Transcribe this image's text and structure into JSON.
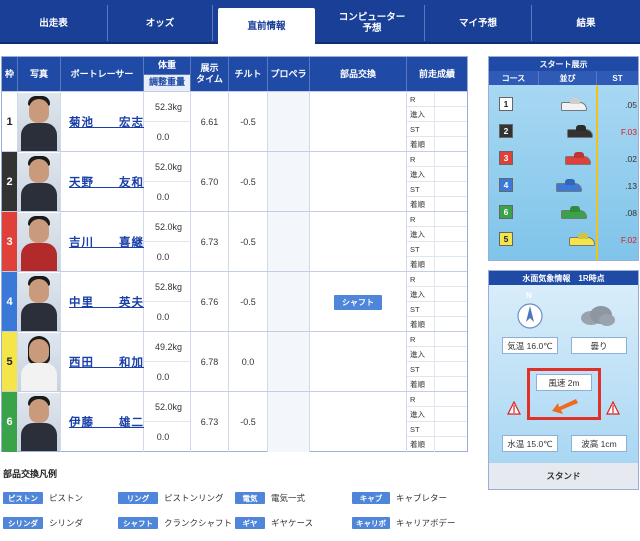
{
  "tabs": [
    {
      "label": "出走表"
    },
    {
      "label": "オッズ"
    },
    {
      "label": "直前情報",
      "active": true
    },
    {
      "label": "コンピューター\n予想"
    },
    {
      "label": "マイ予想"
    },
    {
      "label": "結果"
    }
  ],
  "table": {
    "headers": {
      "waku": "枠",
      "photo": "写真",
      "racer": "ボートレーサー",
      "weight_top": "体重",
      "weight_bottom": "調整重量",
      "exhibition": "展示\nタイム",
      "tilt": "チルト",
      "propeller": "プロペラ",
      "parts": "部品交換",
      "recent": "前走成績"
    },
    "recent_labels": [
      "R",
      "進入",
      "ST",
      "着順"
    ],
    "rows": [
      {
        "waku": "1",
        "name": "菊池　　宏志",
        "weight": "52.3kg",
        "adjust": "0.0",
        "time": "6.61",
        "tilt": "-0.5",
        "parts": "",
        "color": "#ffffff",
        "text": "#222"
      },
      {
        "waku": "2",
        "name": "天野　　友和",
        "weight": "52.0kg",
        "adjust": "0.0",
        "time": "6.70",
        "tilt": "-0.5",
        "parts": "",
        "color": "#333333",
        "text": "#ffffff"
      },
      {
        "waku": "3",
        "name": "吉川　　喜継",
        "weight": "52.0kg",
        "adjust": "0.0",
        "time": "6.73",
        "tilt": "-0.5",
        "parts": "",
        "color": "#e0403a",
        "text": "#ffffff"
      },
      {
        "waku": "4",
        "name": "中里　　英夫",
        "weight": "52.8kg",
        "adjust": "0.0",
        "time": "6.76",
        "tilt": "-0.5",
        "parts": "シャフト",
        "color": "#3a79d8",
        "text": "#ffffff"
      },
      {
        "waku": "5",
        "name": "西田　　和加",
        "weight": "49.2kg",
        "adjust": "0.0",
        "time": "6.78",
        "tilt": "0.0",
        "parts": "",
        "color": "#f4e54a",
        "text": "#222"
      },
      {
        "waku": "6",
        "name": "伊藤　　雄二",
        "weight": "52.0kg",
        "adjust": "0.0",
        "time": "6.73",
        "tilt": "-0.5",
        "parts": "",
        "color": "#3aa34a",
        "text": "#ffffff"
      }
    ]
  },
  "legend": {
    "title": "部品交換凡例",
    "items": [
      {
        "badge": "ピストン",
        "text": "ピストン"
      },
      {
        "badge": "リング",
        "text": "ピストンリング"
      },
      {
        "badge": "電気",
        "text": "電気一式"
      },
      {
        "badge": "キャブ",
        "text": "キャブレター"
      },
      {
        "badge": "シリンダ",
        "text": "シリンダ"
      },
      {
        "badge": "シャフト",
        "text": "クランクシャフト"
      },
      {
        "badge": "ギヤ",
        "text": "ギヤケース"
      },
      {
        "badge": "キャリボ",
        "text": "キャリアボデー"
      }
    ]
  },
  "start_panel": {
    "title": "スタート展示",
    "col_course": "コース",
    "col_order": "並び",
    "col_st": "ST",
    "entries": [
      {
        "course": "1",
        "st": ".05",
        "flying": false,
        "color": "#ffffff",
        "text": "#222",
        "boat": "#f2f2f2"
      },
      {
        "course": "2",
        "st": "F.03",
        "flying": true,
        "color": "#333333",
        "text": "#ffffff",
        "boat": "#333333"
      },
      {
        "course": "3",
        "st": ".02",
        "flying": false,
        "color": "#e0403a",
        "text": "#ffffff",
        "boat": "#e0403a"
      },
      {
        "course": "4",
        "st": ".13",
        "flying": false,
        "color": "#3a79d8",
        "text": "#ffffff",
        "boat": "#3a79d8"
      },
      {
        "course": "6",
        "st": ".08",
        "flying": false,
        "color": "#3aa34a",
        "text": "#ffffff",
        "boat": "#3aa34a"
      },
      {
        "course": "5",
        "st": "F.02",
        "flying": true,
        "color": "#f4e54a",
        "text": "#222",
        "boat": "#f4e54a"
      }
    ]
  },
  "weather": {
    "title": "水面気象情報　1R時点",
    "compass": "N",
    "air_temp": "気温 16.0℃",
    "condition": "曇り",
    "wind": "風速 2m",
    "water_temp": "水温 15.0℃",
    "wave": "波高 1cm",
    "stand": "スタンド"
  }
}
